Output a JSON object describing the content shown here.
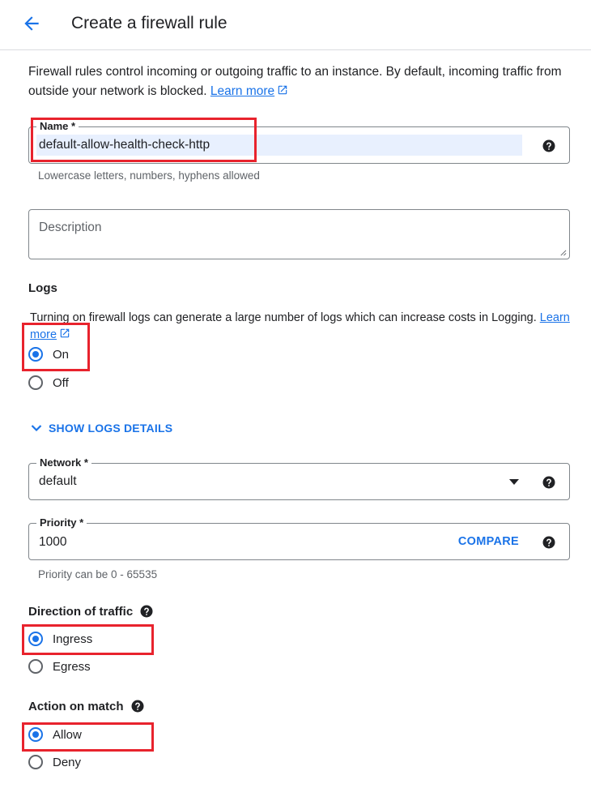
{
  "header": {
    "title": "Create a firewall rule"
  },
  "intro": {
    "text": "Firewall rules control incoming or outgoing traffic to an instance. By default, incoming traffic from outside your network is blocked. ",
    "learn_more": "Learn more"
  },
  "name_field": {
    "label": "Name *",
    "value": "default-allow-health-check-http",
    "hint": "Lowercase letters, numbers, hyphens allowed"
  },
  "description_field": {
    "placeholder": "Description"
  },
  "logs": {
    "title": "Logs",
    "note": "Turning on firewall logs can generate a large number of logs which can increase costs in Logging. ",
    "learn_more": "Learn more",
    "options": [
      {
        "label": "On",
        "checked": true
      },
      {
        "label": "Off",
        "checked": false
      }
    ],
    "show_details": "SHOW LOGS DETAILS"
  },
  "network_field": {
    "label": "Network *",
    "value": "default"
  },
  "priority_field": {
    "label": "Priority *",
    "value": "1000",
    "compare": "COMPARE",
    "hint": "Priority can be 0 - 65535"
  },
  "direction": {
    "title": "Direction of traffic",
    "options": [
      {
        "label": "Ingress",
        "checked": true
      },
      {
        "label": "Egress",
        "checked": false
      }
    ]
  },
  "action": {
    "title": "Action on match",
    "options": [
      {
        "label": "Allow",
        "checked": true
      },
      {
        "label": "Deny",
        "checked": false
      }
    ]
  },
  "colors": {
    "accent": "#1a73e8",
    "highlight": "#e8f0fe",
    "annotation": "#e8232d"
  }
}
